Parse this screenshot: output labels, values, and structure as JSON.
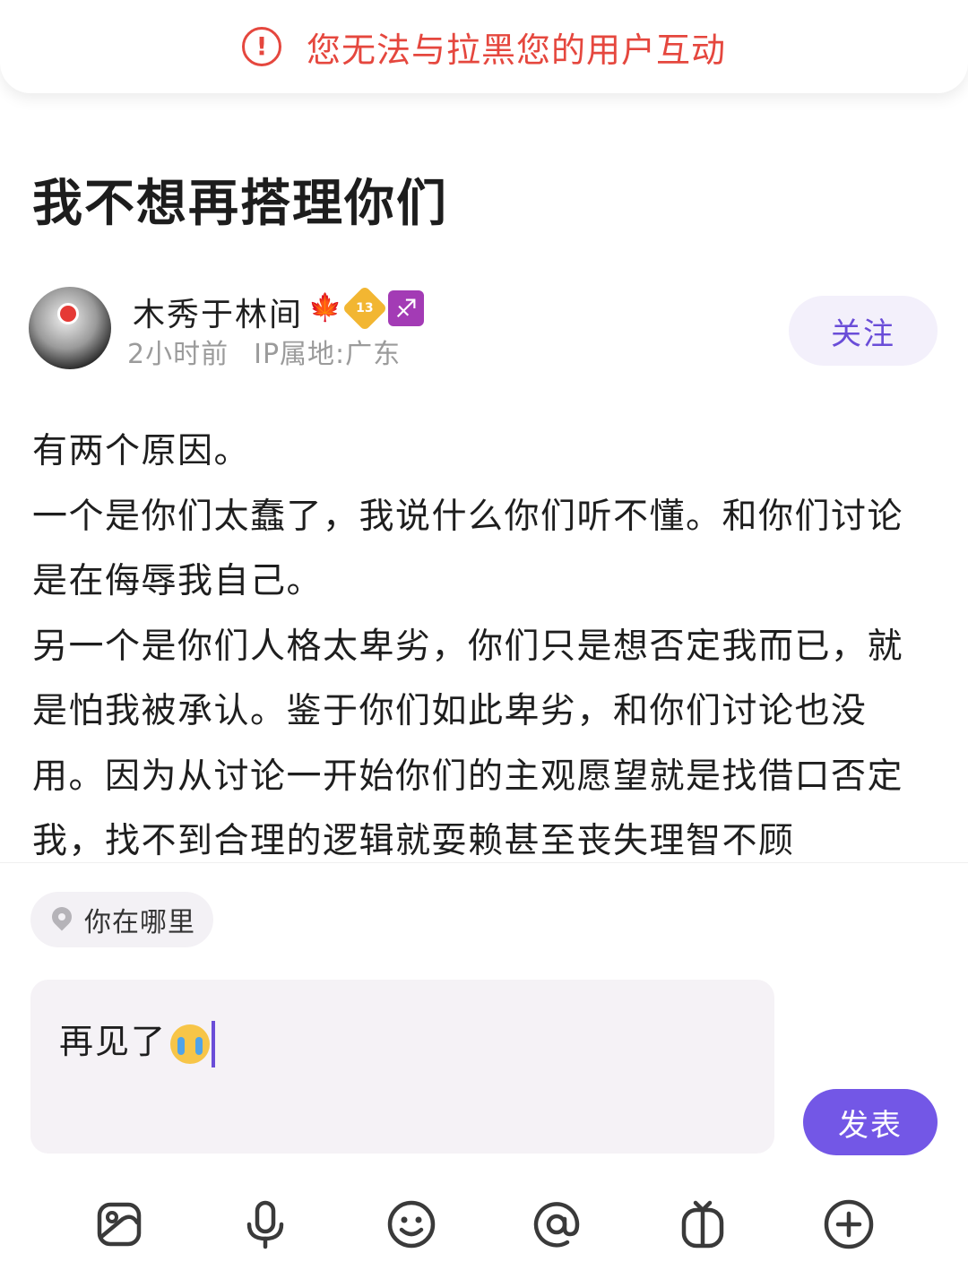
{
  "toast": {
    "icon": "alert-circle-icon",
    "text": "您无法与拉黑您的用户互动",
    "color": "#e5473e"
  },
  "post": {
    "title": "我不想再搭理你们",
    "author": {
      "name": "木秀于林间",
      "level": "13",
      "time": "2小时前",
      "ip": "IP属地:广东"
    },
    "follow_label": "关注",
    "paragraphs": [
      "有两个原因。",
      "一个是你们太蠢了，我说什么你们听不懂。和你们讨论是在侮辱我自己。",
      "另一个是你们人格太卑劣，你们只是想否定我而已，就是怕我被承认。鉴于你们如此卑劣，和你们讨论也没用。因为从讨论一开始你们的主观愿望就是找借口否定我，找不到合理的逻辑就耍赖甚至丧失理智不顾"
    ]
  },
  "editor": {
    "location_label": "你在哪里",
    "input_value": "再见了",
    "publish_label": "发表",
    "tools": [
      "image-icon",
      "microphone-icon",
      "emoji-icon",
      "mention-icon",
      "gift-icon",
      "add-icon"
    ]
  },
  "colors": {
    "accent": "#7357e6",
    "follow_bg": "#f3f0fb"
  }
}
